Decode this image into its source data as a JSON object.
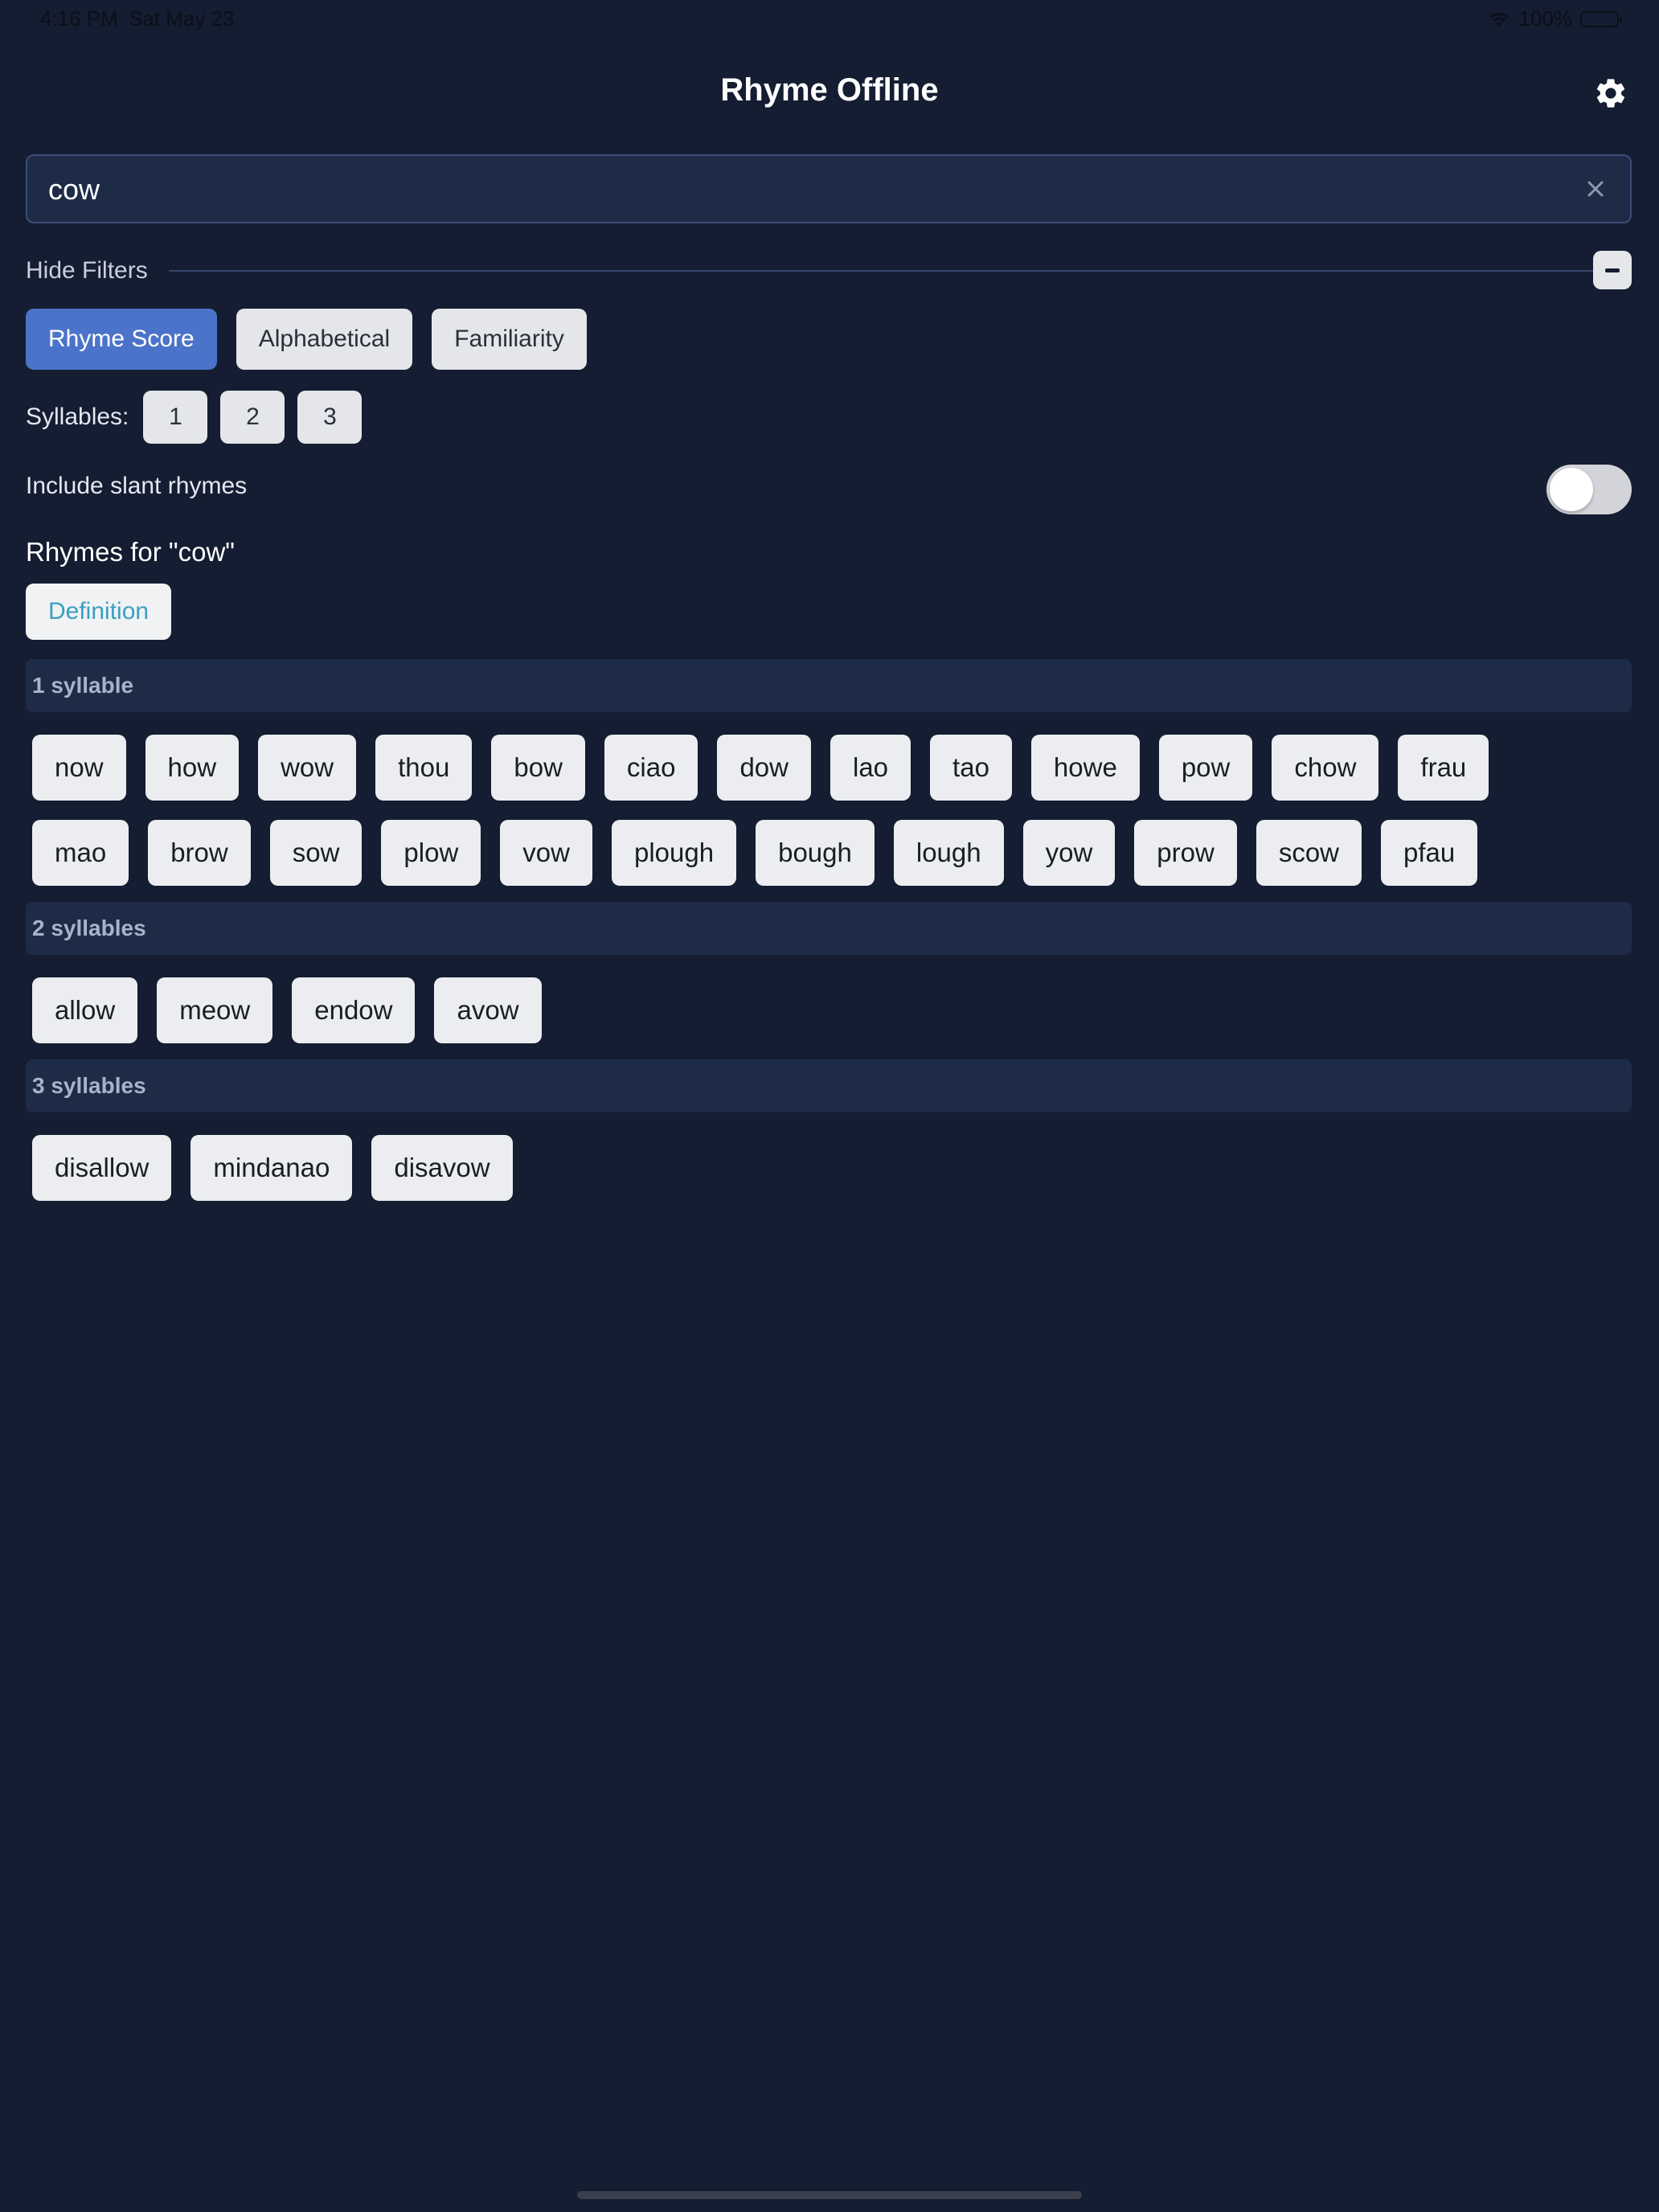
{
  "status_bar": {
    "time": "4:16 PM",
    "date": "Sat May 23",
    "battery": "100%"
  },
  "header": {
    "title": "Rhyme Offline",
    "settings_icon": "gear-icon"
  },
  "search": {
    "value": "cow",
    "clear_icon": "close-icon"
  },
  "filters": {
    "toggle_label": "Hide Filters",
    "sort_options": [
      {
        "label": "Rhyme Score",
        "active": true
      },
      {
        "label": "Alphabetical",
        "active": false
      },
      {
        "label": "Familiarity",
        "active": false
      }
    ],
    "syllables_label": "Syllables:",
    "syllable_options": [
      "1",
      "2",
      "3"
    ],
    "slant_label": "Include slant rhymes",
    "slant_enabled": false
  },
  "results": {
    "title": "Rhymes for \"cow\"",
    "definition_label": "Definition",
    "sections": [
      {
        "header": "1 syllable",
        "rows": [
          [
            "now",
            "how",
            "wow",
            "thou",
            "bow",
            "ciao",
            "dow",
            "lao",
            "tao",
            "howe",
            "pow",
            "chow",
            "frau"
          ],
          [
            "mao",
            "brow",
            "sow",
            "plow",
            "vow",
            "plough",
            "bough",
            "lough",
            "yow",
            "prow",
            "scow",
            "pfau"
          ]
        ]
      },
      {
        "header": "2 syllables",
        "rows": [
          [
            "allow",
            "meow",
            "endow",
            "avow"
          ]
        ]
      },
      {
        "header": "3 syllables",
        "rows": [
          [
            "disallow",
            "mindanao",
            "disavow"
          ]
        ]
      }
    ]
  },
  "colors": {
    "background": "#141d31",
    "panel": "#1e2b47",
    "accent": "#4b73c9",
    "chip": "#ecedf0",
    "definition_text": "#3a9fbf"
  }
}
